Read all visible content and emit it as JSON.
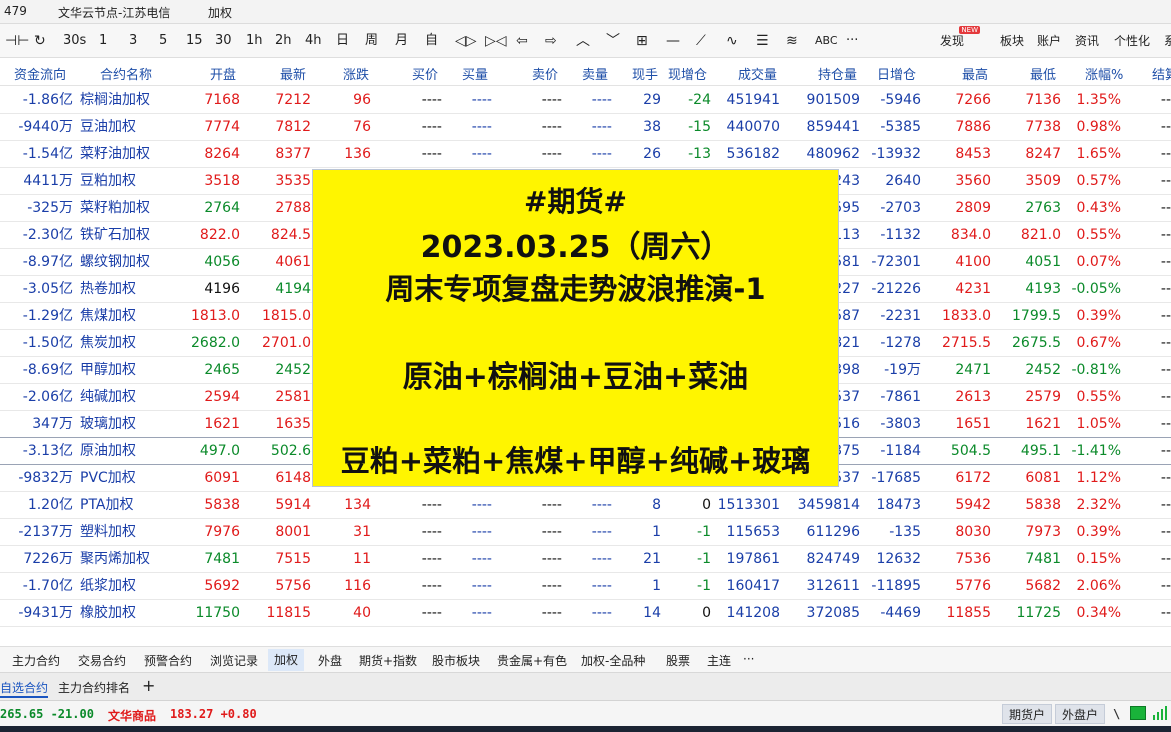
{
  "titlebar": {
    "left_number": "479",
    "server": "文华云节点-江苏电信",
    "mode": "加权"
  },
  "toolbar": {
    "icons": [
      "split-icon",
      "refresh-icon"
    ],
    "periods": [
      "30s",
      "1",
      "3",
      "5",
      "15",
      "30",
      "1h",
      "2h",
      "4h",
      "日",
      "周",
      "月",
      "自"
    ],
    "tool_icons": [
      "zoom-in-icon",
      "zoom-out-icon",
      "left-icon",
      "right-icon",
      "up-icon",
      "down-icon",
      "layout-icon",
      "line-icon",
      "draw-icon",
      "wave-icon",
      "grid-icon",
      "fan-icon"
    ],
    "abc": "ABC",
    "more": "···",
    "discover": "发现",
    "new_badge": "NEW",
    "menu": [
      "板块",
      "账户",
      "资讯",
      "个性化",
      "系"
    ]
  },
  "columns": [
    "资金流向",
    "合约名称",
    "开盘",
    "最新",
    "涨跌",
    "买价",
    "买量",
    "卖价",
    "卖量",
    "现手",
    "现增仓",
    "成交量",
    "持仓量",
    "日增仓",
    "最高",
    "最低",
    "涨幅%",
    "结算"
  ],
  "rows": [
    {
      "flow": "-1.86亿",
      "name": "棕榈油加权",
      "open": "7168",
      "open_c": "red",
      "last": "7212",
      "last_c": "red",
      "chg": "96",
      "chg_c": "red",
      "bid": "----",
      "bidv": "----",
      "ask": "----",
      "askv": "----",
      "hand": "29",
      "hinc": "-24",
      "hinc_c": "green",
      "vol": "451941",
      "oi": "901509",
      "doi": "-5946",
      "high": "7266",
      "high_c": "red",
      "low": "7136",
      "low_c": "red",
      "pct": "1.35%",
      "pct_c": "red",
      "settle": "--"
    },
    {
      "flow": "-9440万",
      "name": "豆油加权",
      "open": "7774",
      "open_c": "red",
      "last": "7812",
      "last_c": "red",
      "chg": "76",
      "chg_c": "red",
      "bid": "----",
      "bidv": "----",
      "ask": "----",
      "askv": "----",
      "hand": "38",
      "hinc": "-15",
      "hinc_c": "green",
      "vol": "440070",
      "oi": "859441",
      "doi": "-5385",
      "high": "7886",
      "high_c": "red",
      "low": "7738",
      "low_c": "red",
      "pct": "0.98%",
      "pct_c": "red",
      "settle": "--"
    },
    {
      "flow": "-1.54亿",
      "name": "菜籽油加权",
      "open": "8264",
      "open_c": "red",
      "last": "8377",
      "last_c": "red",
      "chg": "136",
      "chg_c": "red",
      "bid": "----",
      "bidv": "----",
      "ask": "----",
      "askv": "----",
      "hand": "26",
      "hinc": "-13",
      "hinc_c": "green",
      "vol": "536182",
      "oi": "480962",
      "doi": "-13932",
      "high": "8453",
      "high_c": "red",
      "low": "8247",
      "low_c": "red",
      "pct": "1.65%",
      "pct_c": "red",
      "settle": "--"
    },
    {
      "flow": "4411万",
      "name": "豆粕加权",
      "open": "3518",
      "open_c": "red",
      "last": "3535",
      "last_c": "red",
      "chg": "",
      "chg_c": "red",
      "bid": "",
      "bidv": "",
      "ask": "",
      "askv": "",
      "hand": "",
      "hinc": "",
      "hinc_c": "green",
      "vol": "",
      "oi": "243",
      "doi": "2640",
      "high": "3560",
      "high_c": "red",
      "low": "3509",
      "low_c": "red",
      "pct": "0.57%",
      "pct_c": "red",
      "settle": "--"
    },
    {
      "flow": "-325万",
      "name": "菜籽粕加权",
      "open": "2764",
      "open_c": "green",
      "last": "2788",
      "last_c": "red",
      "chg": "",
      "chg_c": "red",
      "bid": "",
      "bidv": "",
      "ask": "",
      "askv": "",
      "hand": "",
      "hinc": "",
      "hinc_c": "green",
      "vol": "",
      "oi": "595",
      "doi": "-2703",
      "high": "2809",
      "high_c": "red",
      "low": "2763",
      "low_c": "green",
      "pct": "0.43%",
      "pct_c": "red",
      "settle": "--"
    },
    {
      "flow": "-2.30亿",
      "name": "铁矿石加权",
      "open": "822.0",
      "open_c": "red",
      "last": "824.5",
      "last_c": "red",
      "chg": "",
      "chg_c": "red",
      "bid": "",
      "bidv": "",
      "ask": "",
      "askv": "",
      "hand": "",
      "hinc": "",
      "hinc_c": "green",
      "vol": "",
      "oi": "113",
      "doi": "-1132",
      "high": "834.0",
      "high_c": "red",
      "low": "821.0",
      "low_c": "red",
      "pct": "0.55%",
      "pct_c": "red",
      "settle": "--"
    },
    {
      "flow": "-8.97亿",
      "name": "螺纹钢加权",
      "open": "4056",
      "open_c": "green",
      "last": "4061",
      "last_c": "red",
      "chg": "",
      "chg_c": "red",
      "bid": "",
      "bidv": "",
      "ask": "",
      "askv": "",
      "hand": "",
      "hinc": "",
      "hinc_c": "green",
      "vol": "",
      "oi": "581",
      "doi": "-72301",
      "high": "4100",
      "high_c": "red",
      "low": "4051",
      "low_c": "green",
      "pct": "0.07%",
      "pct_c": "red",
      "settle": "--"
    },
    {
      "flow": "-3.05亿",
      "name": "热卷加权",
      "open": "4196",
      "open_c": "blk",
      "last": "4194",
      "last_c": "green",
      "chg": "",
      "chg_c": "green",
      "bid": "",
      "bidv": "",
      "ask": "",
      "askv": "",
      "hand": "",
      "hinc": "",
      "hinc_c": "green",
      "vol": "",
      "oi": "227",
      "doi": "-21226",
      "high": "4231",
      "high_c": "red",
      "low": "4193",
      "low_c": "green",
      "pct": "-0.05%",
      "pct_c": "green",
      "settle": "--"
    },
    {
      "flow": "-1.29亿",
      "name": "焦煤加权",
      "open": "1813.0",
      "open_c": "red",
      "last": "1815.0",
      "last_c": "red",
      "chg": "",
      "chg_c": "red",
      "bid": "",
      "bidv": "",
      "ask": "",
      "askv": "",
      "hand": "",
      "hinc": "",
      "hinc_c": "green",
      "vol": "",
      "oi": "587",
      "doi": "-2231",
      "high": "1833.0",
      "high_c": "red",
      "low": "1799.5",
      "low_c": "green",
      "pct": "0.39%",
      "pct_c": "red",
      "settle": "--"
    },
    {
      "flow": "-1.50亿",
      "name": "焦炭加权",
      "open": "2682.0",
      "open_c": "green",
      "last": "2701.0",
      "last_c": "red",
      "chg": "",
      "chg_c": "red",
      "bid": "",
      "bidv": "",
      "ask": "",
      "askv": "",
      "hand": "",
      "hinc": "",
      "hinc_c": "green",
      "vol": "",
      "oi": "821",
      "doi": "-1278",
      "high": "2715.5",
      "high_c": "red",
      "low": "2675.5",
      "low_c": "green",
      "pct": "0.67%",
      "pct_c": "red",
      "settle": "--"
    },
    {
      "flow": "-8.69亿",
      "name": "甲醇加权",
      "open": "2465",
      "open_c": "green",
      "last": "2452",
      "last_c": "green",
      "chg": "",
      "chg_c": "green",
      "bid": "",
      "bidv": "",
      "ask": "",
      "askv": "",
      "hand": "",
      "hinc": "",
      "hinc_c": "green",
      "vol": "",
      "oi": "398",
      "doi": "-19万",
      "high": "2471",
      "high_c": "green",
      "low": "2452",
      "low_c": "green",
      "pct": "-0.81%",
      "pct_c": "green",
      "settle": "--"
    },
    {
      "flow": "-2.06亿",
      "name": "纯碱加权",
      "open": "2594",
      "open_c": "red",
      "last": "2581",
      "last_c": "red",
      "chg": "",
      "chg_c": "red",
      "bid": "",
      "bidv": "",
      "ask": "",
      "askv": "",
      "hand": "",
      "hinc": "",
      "hinc_c": "green",
      "vol": "",
      "oi": "537",
      "doi": "-7861",
      "high": "2613",
      "high_c": "red",
      "low": "2579",
      "low_c": "red",
      "pct": "0.55%",
      "pct_c": "red",
      "settle": "--"
    },
    {
      "flow": "347万",
      "name": "玻璃加权",
      "open": "1621",
      "open_c": "red",
      "last": "1635",
      "last_c": "red",
      "chg": "",
      "chg_c": "red",
      "bid": "",
      "bidv": "",
      "ask": "",
      "askv": "",
      "hand": "",
      "hinc": "",
      "hinc_c": "green",
      "vol": "",
      "oi": "516",
      "doi": "-3803",
      "high": "1651",
      "high_c": "red",
      "low": "1621",
      "low_c": "red",
      "pct": "1.05%",
      "pct_c": "red",
      "settle": "--"
    },
    {
      "flow": "-3.13亿",
      "name": "原油加权",
      "open": "497.0",
      "open_c": "green",
      "last": "502.6",
      "last_c": "green",
      "chg": "",
      "chg_c": "green",
      "bid": "",
      "bidv": "",
      "ask": "",
      "askv": "",
      "hand": "",
      "hinc": "",
      "hinc_c": "green",
      "vol": "",
      "oi": "375",
      "doi": "-1184",
      "high": "504.5",
      "high_c": "green",
      "low": "495.1",
      "low_c": "green",
      "pct": "-1.41%",
      "pct_c": "green",
      "settle": "--"
    },
    {
      "flow": "-9832万",
      "name": "PVC加权",
      "open": "6091",
      "open_c": "red",
      "last": "6148",
      "last_c": "red",
      "chg": "",
      "chg_c": "red",
      "bid": "",
      "bidv": "",
      "ask": "",
      "askv": "",
      "hand": "",
      "hinc": "",
      "hinc_c": "green",
      "vol": "",
      "oi": "537",
      "doi": "-17685",
      "high": "6172",
      "high_c": "red",
      "low": "6081",
      "low_c": "red",
      "pct": "1.12%",
      "pct_c": "red",
      "settle": "--"
    },
    {
      "flow": "1.20亿",
      "name": "PTA加权",
      "open": "5838",
      "open_c": "red",
      "last": "5914",
      "last_c": "red",
      "chg": "134",
      "chg_c": "red",
      "bid": "----",
      "bidv": "----",
      "ask": "----",
      "askv": "----",
      "hand": "8",
      "hinc": "0",
      "hinc_c": "blk",
      "vol": "1513301",
      "oi": "3459814",
      "doi": "18473",
      "high": "5942",
      "high_c": "red",
      "low": "5838",
      "low_c": "red",
      "pct": "2.32%",
      "pct_c": "red",
      "settle": "--"
    },
    {
      "flow": "-2137万",
      "name": "塑料加权",
      "open": "7976",
      "open_c": "red",
      "last": "8001",
      "last_c": "red",
      "chg": "31",
      "chg_c": "red",
      "bid": "----",
      "bidv": "----",
      "ask": "----",
      "askv": "----",
      "hand": "1",
      "hinc": "-1",
      "hinc_c": "green",
      "vol": "115653",
      "oi": "611296",
      "doi": "-135",
      "high": "8030",
      "high_c": "red",
      "low": "7973",
      "low_c": "red",
      "pct": "0.39%",
      "pct_c": "red",
      "settle": "--"
    },
    {
      "flow": "7226万",
      "name": "聚丙烯加权",
      "open": "7481",
      "open_c": "green",
      "last": "7515",
      "last_c": "red",
      "chg": "11",
      "chg_c": "red",
      "bid": "----",
      "bidv": "----",
      "ask": "----",
      "askv": "----",
      "hand": "21",
      "hinc": "-1",
      "hinc_c": "green",
      "vol": "197861",
      "oi": "824749",
      "doi": "12632",
      "high": "7536",
      "high_c": "red",
      "low": "7481",
      "low_c": "green",
      "pct": "0.15%",
      "pct_c": "red",
      "settle": "--"
    },
    {
      "flow": "-1.70亿",
      "name": "纸浆加权",
      "open": "5692",
      "open_c": "red",
      "last": "5756",
      "last_c": "red",
      "chg": "116",
      "chg_c": "red",
      "bid": "----",
      "bidv": "----",
      "ask": "----",
      "askv": "----",
      "hand": "1",
      "hinc": "-1",
      "hinc_c": "green",
      "vol": "160417",
      "oi": "312611",
      "doi": "-11895",
      "high": "5776",
      "high_c": "red",
      "low": "5682",
      "low_c": "red",
      "pct": "2.06%",
      "pct_c": "red",
      "settle": "--"
    },
    {
      "flow": "-9431万",
      "name": "橡胶加权",
      "open": "11750",
      "open_c": "green",
      "last": "11815",
      "last_c": "red",
      "chg": "40",
      "chg_c": "red",
      "bid": "----",
      "bidv": "----",
      "ask": "----",
      "askv": "----",
      "hand": "14",
      "hinc": "0",
      "hinc_c": "blk",
      "vol": "141208",
      "oi": "372085",
      "doi": "-4469",
      "high": "11855",
      "high_c": "red",
      "low": "11725",
      "low_c": "green",
      "pct": "0.34%",
      "pct_c": "red",
      "settle": "--"
    }
  ],
  "overlay": {
    "tag": "#期货#",
    "date": "2023.03.25（周六）",
    "title": "周末专项复盘走势波浪推演-1",
    "line1": "原油+棕榈油+豆油+菜油",
    "line2": "豆粕+菜粕+焦煤+甲醇+纯碱+玻璃"
  },
  "tabs": [
    "主力合约",
    "交易合约",
    "预警合约",
    "浏览记录",
    "加权",
    "外盘",
    "期货+指数",
    "股市板块",
    "贵金属+有色",
    "加权-全品种",
    "股票",
    "主连",
    "···"
  ],
  "active_tab": "加权",
  "subtabs": {
    "items": [
      "自选合约",
      "主力合约排名"
    ],
    "add": "+"
  },
  "status": {
    "index1": "265.65 -21.00",
    "index2_name": "文华商品",
    "index2_value": "183.27 +0.80",
    "btn1": "期货户",
    "btn2": "外盘户",
    "sep": "\\"
  },
  "colors": {
    "red": "#e01a1a",
    "green": "#0b8a2a",
    "header_blue": "#1f4fa8",
    "overlay_yellow": "#fff500"
  }
}
